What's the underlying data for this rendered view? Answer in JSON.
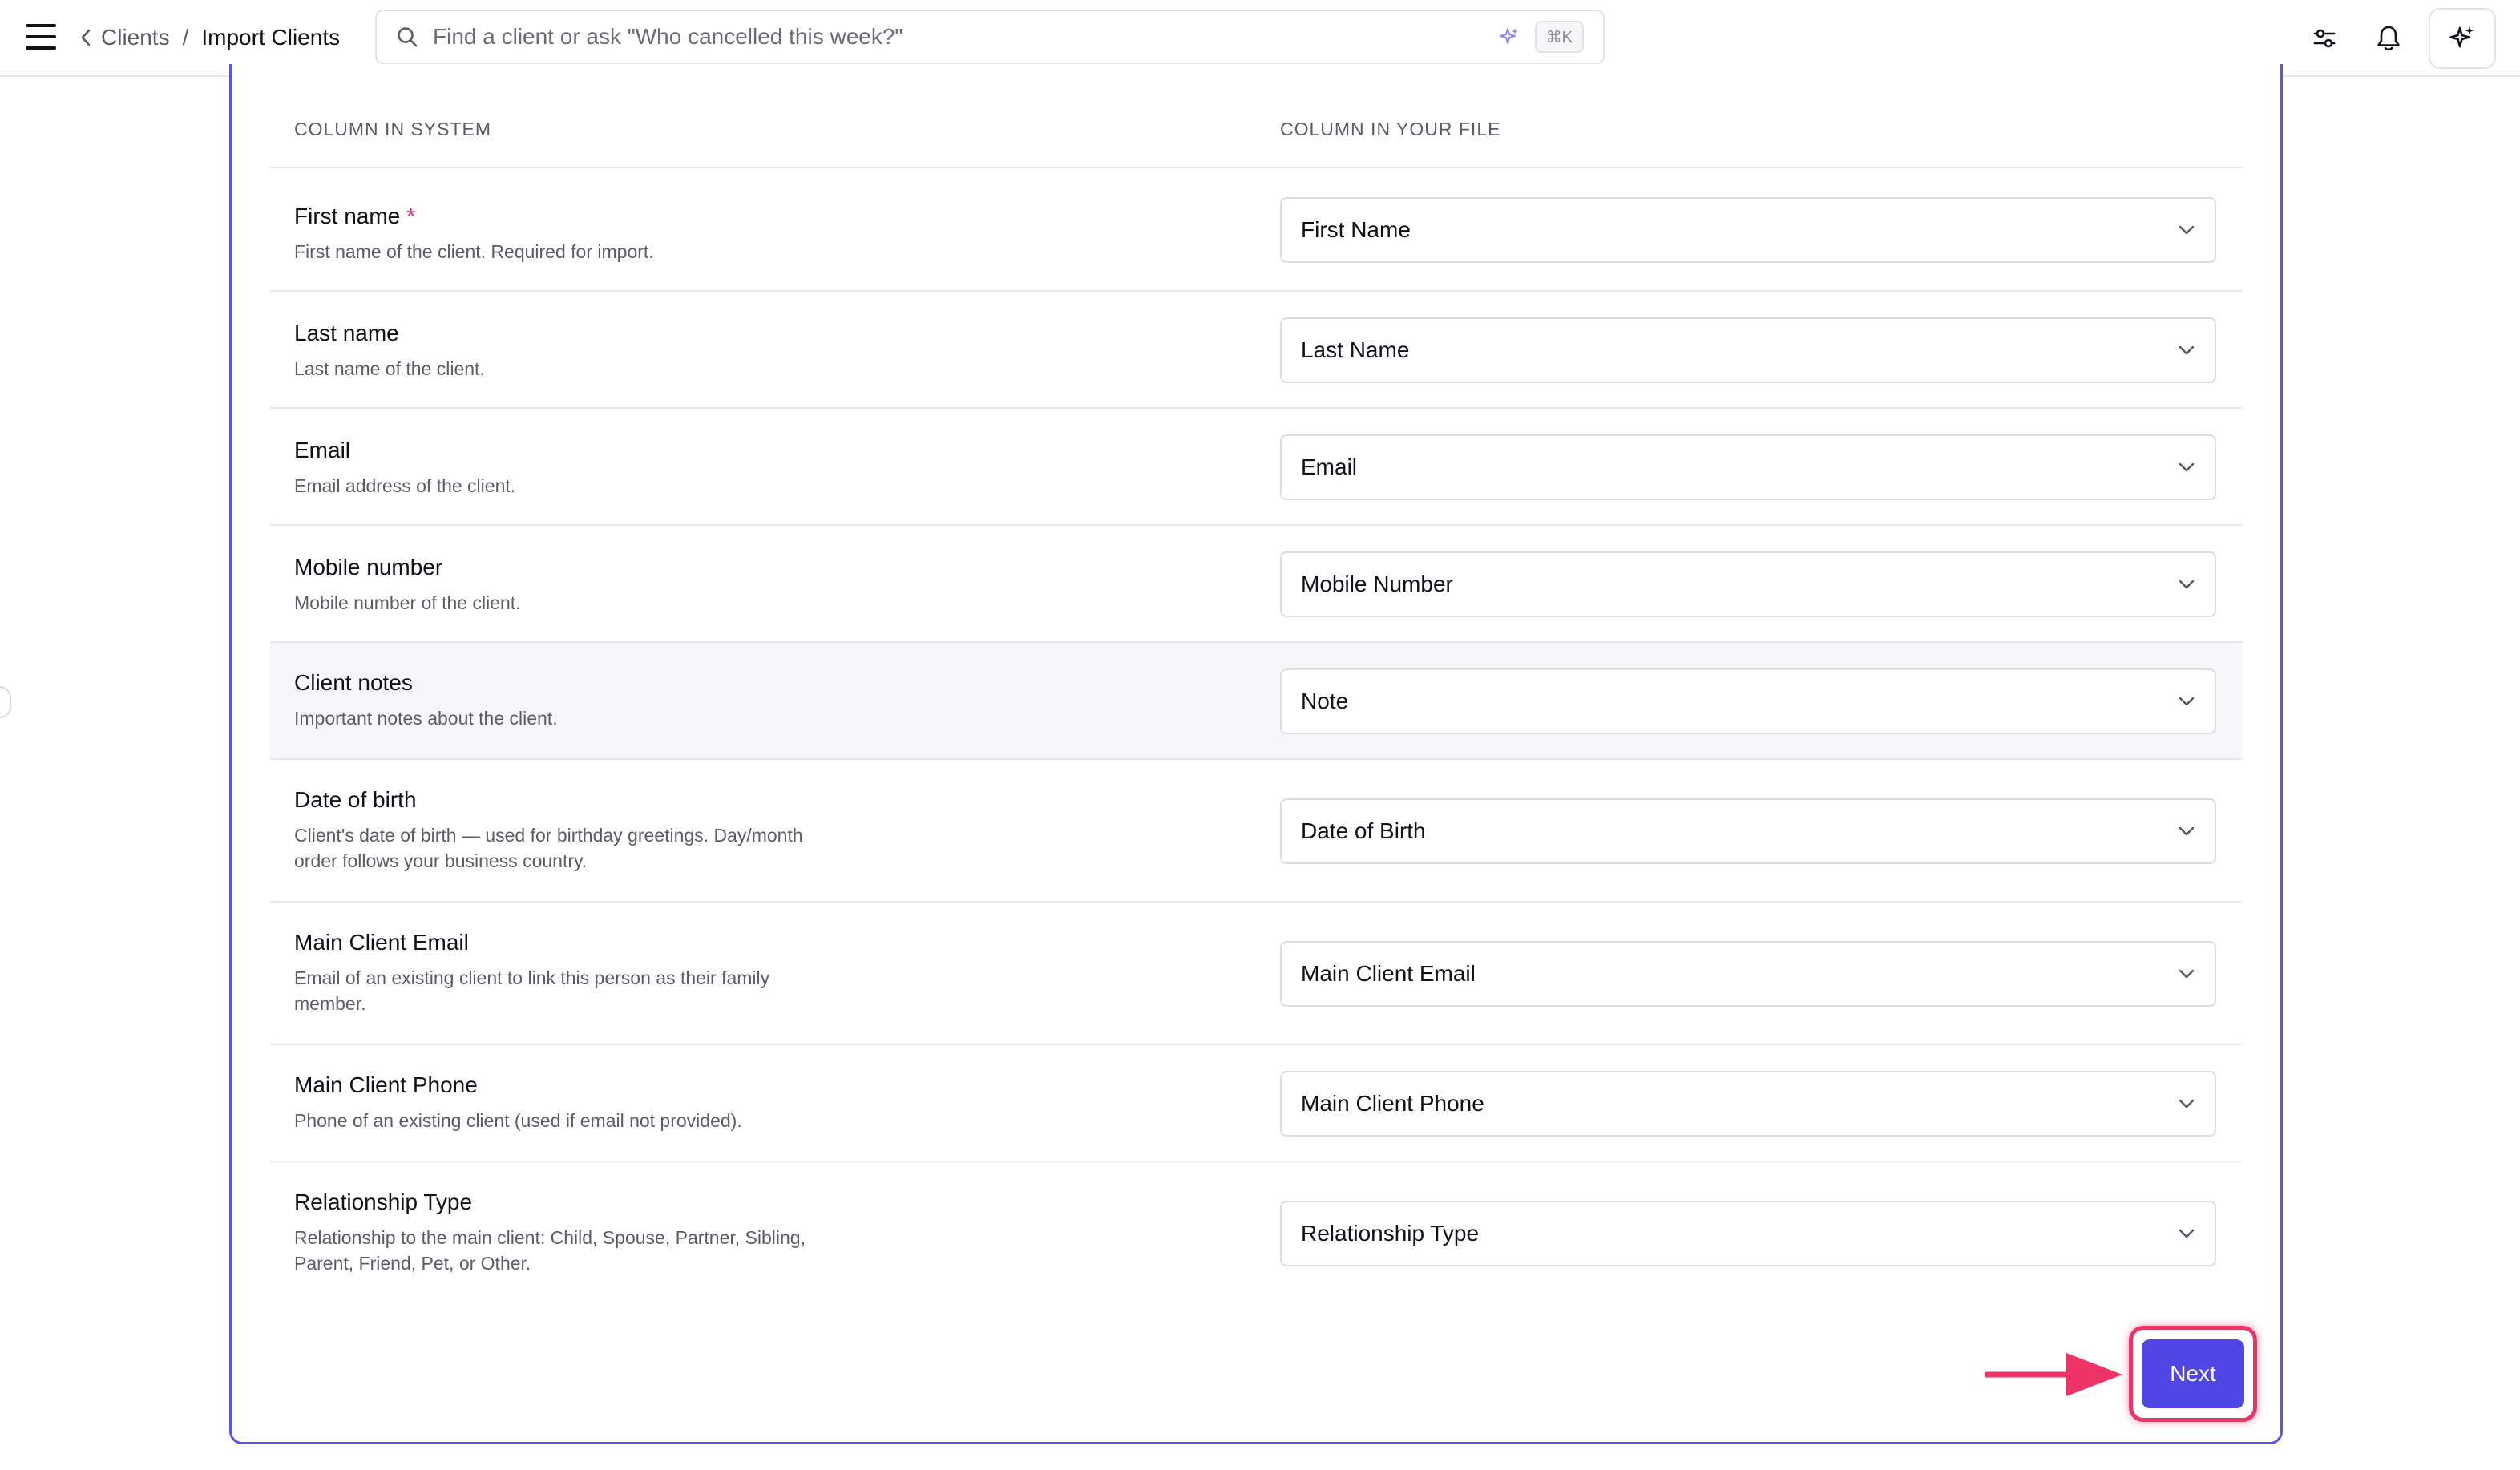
{
  "header": {
    "breadcrumb_parent": "Clients",
    "breadcrumb_separator": "/",
    "breadcrumb_current": "Import Clients",
    "search_placeholder": "Find a client or ask \"Who cancelled this week?\"",
    "search_shortcut": "⌘K"
  },
  "table": {
    "col_system": "COLUMN IN SYSTEM",
    "col_file": "COLUMN IN YOUR FILE",
    "rows": [
      {
        "label": "First name",
        "required": "*",
        "desc": "First name of the client. Required for import.",
        "value": "First Name"
      },
      {
        "label": "Last name",
        "desc": "Last name of the client.",
        "value": "Last Name"
      },
      {
        "label": "Email",
        "desc": "Email address of the client.",
        "value": "Email"
      },
      {
        "label": "Mobile number",
        "desc": "Mobile number of the client.",
        "value": "Mobile Number"
      },
      {
        "label": "Client notes",
        "desc": "Important notes about the client.",
        "value": "Note"
      },
      {
        "label": "Date of birth",
        "desc": "Client's date of birth — used for birthday greetings. Day/month order follows your business country.",
        "value": "Date of Birth"
      },
      {
        "label": "Main Client Email",
        "desc": "Email of an existing client to link this person as their family member.",
        "value": "Main Client Email"
      },
      {
        "label": "Main Client Phone",
        "desc": "Phone of an existing client (used if email not provided).",
        "value": "Main Client Phone"
      },
      {
        "label": "Relationship Type",
        "desc": "Relationship to the main client: Child, Spouse, Partner, Sibling, Parent, Friend, Pet, or Other.",
        "value": "Relationship Type"
      }
    ]
  },
  "actions": {
    "next_label": "Next"
  },
  "colors": {
    "accent": "#4f46e5",
    "card_border": "#5b55e6",
    "highlight": "#ee3366"
  },
  "icons": {
    "menu": "hamburger-menu-icon",
    "back": "chevron-left-icon",
    "search": "search-icon",
    "ai": "sparkles-icon",
    "filter": "sliders-icon",
    "bell": "bell-icon",
    "select": "chevron-down-icon",
    "pointer": "arrow-right-icon"
  }
}
